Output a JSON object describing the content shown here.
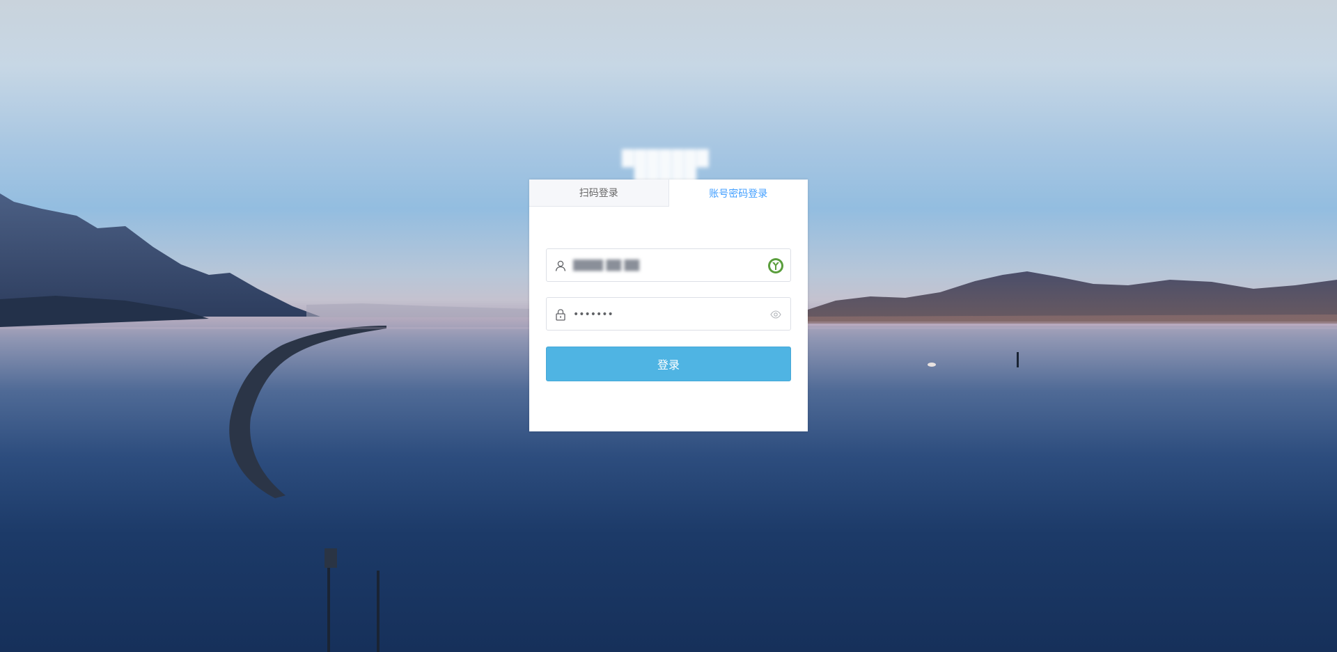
{
  "site": {
    "title": "███████ █████"
  },
  "tabs": [
    {
      "label": "扫码登录",
      "active": false
    },
    {
      "label": "账号密码登录",
      "active": true
    }
  ],
  "login": {
    "username_value": "████ ██ ██",
    "password_value": "•••••••",
    "submit_label": "登录"
  },
  "icons": {
    "username_prefix": "user-icon",
    "username_suffix": "password-manager-icon",
    "password_prefix": "lock-icon",
    "password_suffix": "eye-icon"
  },
  "colors": {
    "accent": "#409eff",
    "button": "#4fb4e3",
    "autofill_icon": "#5a9e3c"
  }
}
